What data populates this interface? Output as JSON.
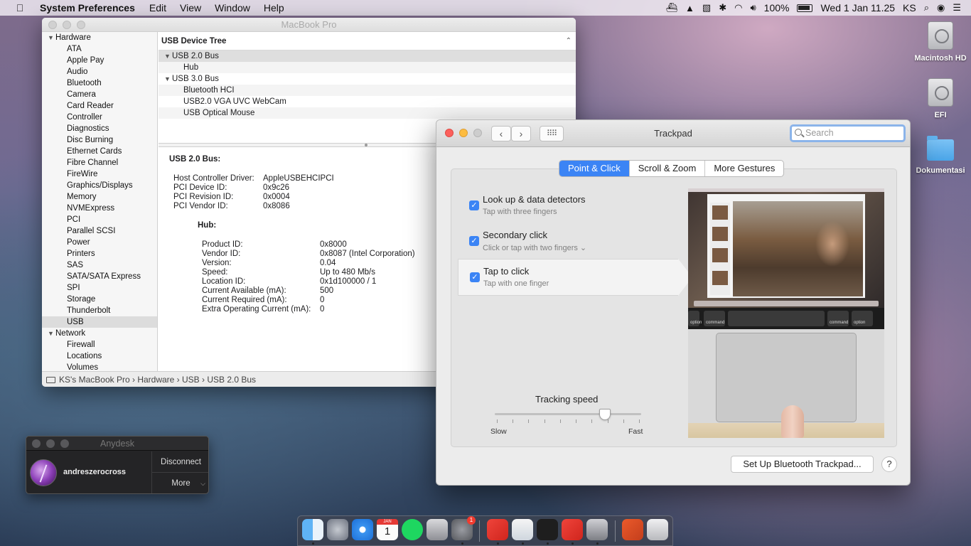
{
  "menubar": {
    "app_name": "System Preferences",
    "menus": [
      "Edit",
      "View",
      "Window",
      "Help"
    ],
    "battery": "100%",
    "clock": "Wed 1 Jan  11.25",
    "user": "KS"
  },
  "desktop": {
    "icons": [
      "Macintosh HD",
      "EFI",
      "Dokumentasi"
    ]
  },
  "sysinfo": {
    "title": "MacBook Pro",
    "sidebar": {
      "hardware_label": "Hardware",
      "hardware_items": [
        "ATA",
        "Apple Pay",
        "Audio",
        "Bluetooth",
        "Camera",
        "Card Reader",
        "Controller",
        "Diagnostics",
        "Disc Burning",
        "Ethernet Cards",
        "Fibre Channel",
        "FireWire",
        "Graphics/Displays",
        "Memory",
        "NVMExpress",
        "PCI",
        "Parallel SCSI",
        "Power",
        "Printers",
        "SAS",
        "SATA/SATA Express",
        "SPI",
        "Storage",
        "Thunderbolt",
        "USB"
      ],
      "selected": "USB",
      "network_label": "Network",
      "network_items": [
        "Firewall",
        "Locations",
        "Volumes"
      ]
    },
    "tree": {
      "header": "USB Device Tree",
      "bus1": "USB 2.0 Bus",
      "bus1_devices": [
        "Hub"
      ],
      "bus2": "USB 3.0 Bus",
      "bus2_devices": [
        "Bluetooth HCI",
        "USB2.0 VGA UVC WebCam",
        "USB Optical Mouse"
      ]
    },
    "detail": {
      "heading": "USB 2.0 Bus:",
      "bus_props": [
        {
          "k": "Host Controller Driver:",
          "v": "AppleUSBEHCIPCI"
        },
        {
          "k": "PCI Device ID:",
          "v": "0x9c26"
        },
        {
          "k": "PCI Revision ID:",
          "v": "0x0004"
        },
        {
          "k": "PCI Vendor ID:",
          "v": "0x8086"
        }
      ],
      "hub_heading": "Hub:",
      "hub_props": [
        {
          "k": "Product ID:",
          "v": "0x8000"
        },
        {
          "k": "Vendor ID:",
          "v": "0x8087  (Intel Corporation)"
        },
        {
          "k": "Version:",
          "v": "0.04"
        },
        {
          "k": "Speed:",
          "v": "Up to 480 Mb/s"
        },
        {
          "k": "Location ID:",
          "v": "0x1d100000 / 1"
        },
        {
          "k": "Current Available (mA):",
          "v": "500"
        },
        {
          "k": "Current Required (mA):",
          "v": "0"
        },
        {
          "k": "Extra Operating Current (mA):",
          "v": "0"
        }
      ]
    },
    "breadcrumb": "KS's MacBook Pro › Hardware › USB › USB 2.0 Bus"
  },
  "anydesk": {
    "title": "Anydesk",
    "user": "andreszerocross",
    "disconnect": "Disconnect",
    "more": "More"
  },
  "trackpad": {
    "title": "Trackpad",
    "search_placeholder": "Search",
    "tabs": [
      "Point & Click",
      "Scroll & Zoom",
      "More Gestures"
    ],
    "active_tab": "Point & Click",
    "options": [
      {
        "label": "Look up & data detectors",
        "sub": "Tap with three fingers",
        "checked": true
      },
      {
        "label": "Secondary click",
        "sub": "Click or tap with two fingers ⌄",
        "checked": true
      },
      {
        "label": "Tap to click",
        "sub": "Tap with one finger",
        "checked": true
      }
    ],
    "tracking_speed_label": "Tracking speed",
    "slow": "Slow",
    "fast": "Fast",
    "tracking_speed_level": 0.75,
    "touchbar_keys": [
      "option",
      "command",
      "command",
      "option"
    ],
    "setup_button": "Set Up Bluetooth Trackpad...",
    "help": "?"
  },
  "dock": {
    "apps": [
      "finder-icon",
      "launchpad-icon",
      "safari-icon",
      "calendar-icon",
      "spotify-icon",
      "system-information-icon",
      "system-preferences-icon",
      "anydesk-icon",
      "preview-icon",
      "terminal-icon",
      "anydesk-alt-icon",
      "network-utility-icon",
      "office-icon",
      "trash-icon"
    ],
    "calendar_day": "1",
    "calendar_month": "JAN",
    "badge": "1"
  }
}
